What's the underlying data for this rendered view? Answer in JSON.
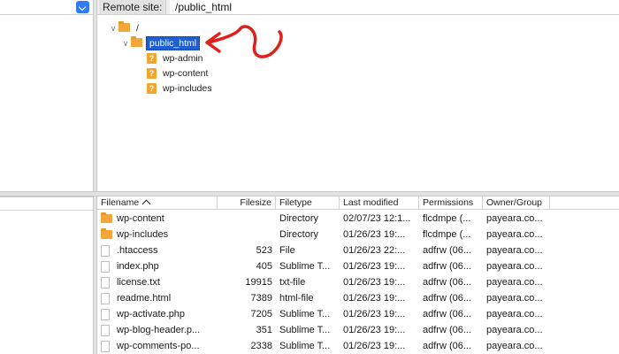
{
  "remote_site": {
    "label": "Remote site:",
    "path": "/public_html"
  },
  "tree": {
    "root": "/",
    "selected": "public_html",
    "children": [
      "wp-admin",
      "wp-content",
      "wp-includes"
    ]
  },
  "file_list": {
    "columns": [
      "Filename",
      "Filesize",
      "Filetype",
      "Last modified",
      "Permissions",
      "Owner/Group"
    ],
    "rows": [
      {
        "name": "wp-content",
        "size": "",
        "type": "Directory",
        "modified": "02/07/23 12:1...",
        "perms": "flcdmpe (...",
        "owner": "payeara.co...",
        "icon": "folder-icon"
      },
      {
        "name": "wp-includes",
        "size": "",
        "type": "Directory",
        "modified": "01/26/23 19:...",
        "perms": "flcdmpe (...",
        "owner": "payeara.co...",
        "icon": "folder-icon"
      },
      {
        "name": ".htaccess",
        "size": "523",
        "type": "File",
        "modified": "01/26/23 22:...",
        "perms": "adfrw (06...",
        "owner": "payeara.co...",
        "icon": "file-icon"
      },
      {
        "name": "index.php",
        "size": "405",
        "type": "Sublime T...",
        "modified": "01/26/23 19:...",
        "perms": "adfrw (06...",
        "owner": "payeara.co...",
        "icon": "file-icon"
      },
      {
        "name": "license.txt",
        "size": "19915",
        "type": "txt-file",
        "modified": "01/26/23 19:...",
        "perms": "adfrw (06...",
        "owner": "payeara.co...",
        "icon": "file-icon"
      },
      {
        "name": "readme.html",
        "size": "7389",
        "type": "html-file",
        "modified": "01/26/23 19:...",
        "perms": "adfrw (06...",
        "owner": "payeara.co...",
        "icon": "file-icon"
      },
      {
        "name": "wp-activate.php",
        "size": "7205",
        "type": "Sublime T...",
        "modified": "01/26/23 19:...",
        "perms": "adfrw (06...",
        "owner": "payeara.co...",
        "icon": "file-icon"
      },
      {
        "name": "wp-blog-header.p...",
        "size": "351",
        "type": "Sublime T...",
        "modified": "01/26/23 19:...",
        "perms": "adfrw (06...",
        "owner": "payeara.co...",
        "icon": "file-icon"
      },
      {
        "name": "wp-comments-po...",
        "size": "2338",
        "type": "Sublime T...",
        "modified": "01/26/23 19:...",
        "perms": "adfrw (06...",
        "owner": "payeara.co...",
        "icon": "file-icon"
      }
    ]
  },
  "colors": {
    "selection": "#1f5fcf",
    "folder": "#f3a73a",
    "annotation_arrow": "#e0201b",
    "dropdown_button": "#2f7cf6"
  }
}
